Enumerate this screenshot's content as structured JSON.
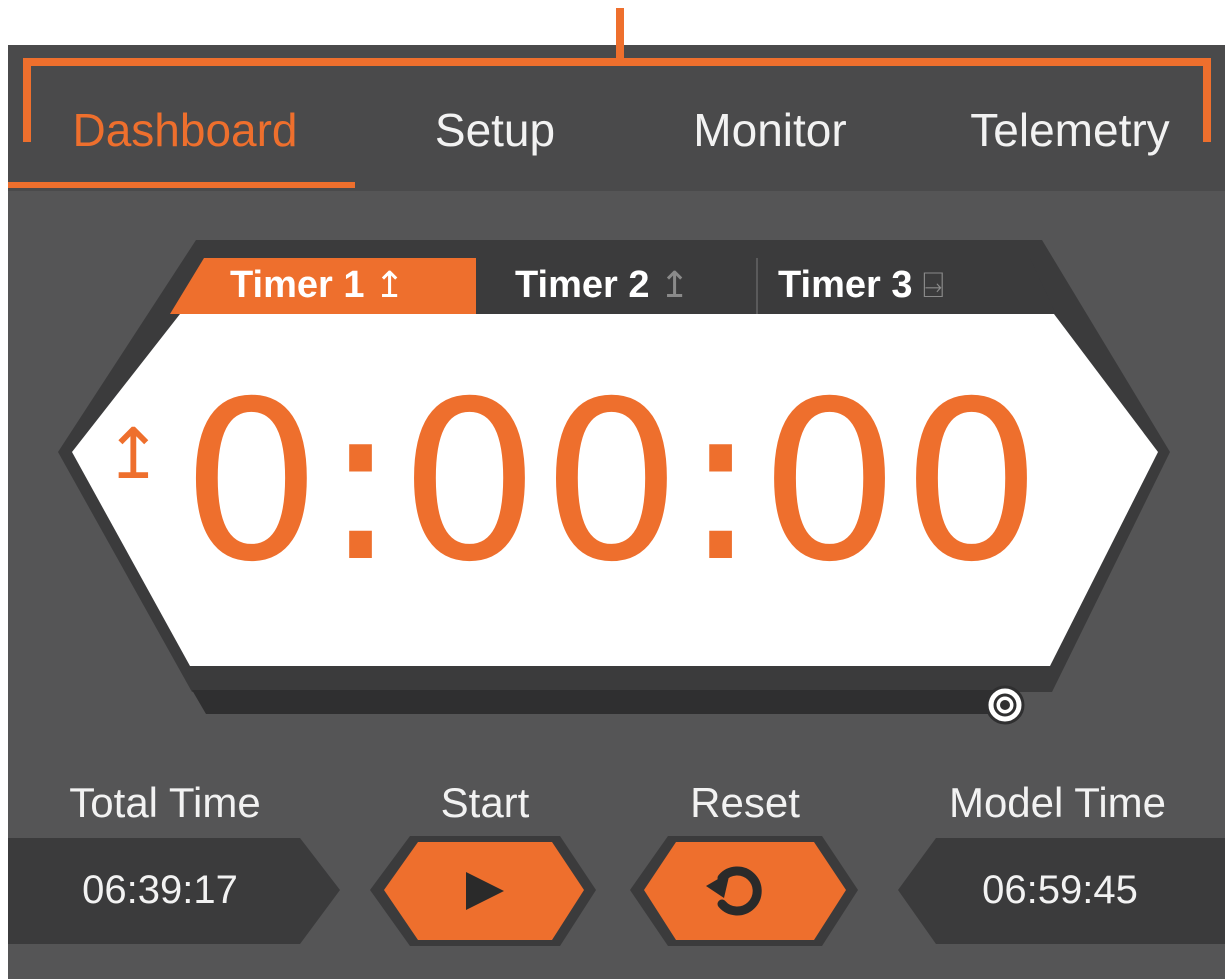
{
  "nav": {
    "tabs": [
      {
        "label": "Dashboard",
        "active": true
      },
      {
        "label": "Setup",
        "active": false
      },
      {
        "label": "Monitor",
        "active": false
      },
      {
        "label": "Telemetry",
        "active": false
      }
    ]
  },
  "timers": {
    "tabs": [
      {
        "label": "Timer 1",
        "icon": "count-up-icon",
        "glyph": "↥",
        "active": true
      },
      {
        "label": "Timer 2",
        "icon": "count-up-icon",
        "glyph": "↥",
        "active": false
      },
      {
        "label": "Timer 3",
        "icon": "count-down-icon",
        "glyph": "⍈",
        "active": false
      }
    ],
    "direction_glyph": "↥",
    "direction_icon": "count-up-icon",
    "display": "0:00:00",
    "progress": 1.0
  },
  "controls": {
    "total_time_label": "Total Time",
    "total_time_value": "06:39:17",
    "start_label": "Start",
    "start_icon": "play-icon",
    "reset_label": "Reset",
    "reset_icon": "reset-icon",
    "model_time_label": "Model Time",
    "model_time_value": "06:59:45"
  },
  "colors": {
    "accent": "#ee6f2d",
    "panel": "#555556",
    "tab_bar": "#4a4a4b",
    "dark_tab": "#3b3b3c",
    "text": "#f2f2f2"
  }
}
